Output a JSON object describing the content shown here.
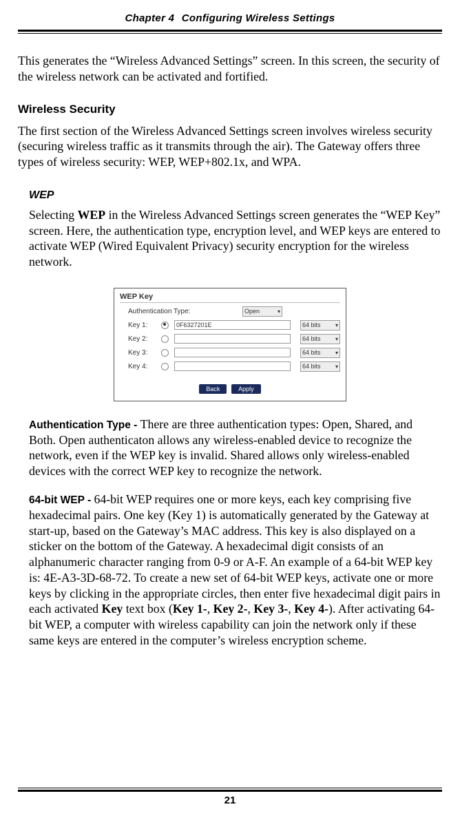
{
  "header": {
    "chapter_label": "Chapter 4",
    "chapter_title": "Configuring Wireless Settings"
  },
  "para_intro": "This generates the “Wireless Advanced Settings” screen. In this screen, the security of the wireless network can be activated and fortified.",
  "sec_wsec_heading": "Wireless Security",
  "para_wsec": "The first section of the Wireless Advanced Settings screen involves wireless security (securing wireless traffic as it transmits through the air). The Gateway offers three types of wireless security: WEP, WEP+802.1x, and WPA.",
  "sub_wep_heading": "WEP",
  "para_wep_pre": "Selecting ",
  "para_wep_bold": "WEP",
  "para_wep_post": " in the Wireless Advanced Settings screen generates the “WEP Key” screen. Here, the authentication type, encryption level, and WEP keys are entered to activate WEP (Wired Equivalent Privacy) security encryption for the wireless network.",
  "figure": {
    "title": "WEP Key",
    "auth_label": "Authentication Type:",
    "auth_value": "Open",
    "keys": [
      {
        "label": "Key 1:",
        "checked": true,
        "value": "0F6327201E",
        "bits": "64 bits"
      },
      {
        "label": "Key 2:",
        "checked": false,
        "value": "",
        "bits": "64 bits"
      },
      {
        "label": "Key 3:",
        "checked": false,
        "value": "",
        "bits": "64 bits"
      },
      {
        "label": "Key 4:",
        "checked": false,
        "value": "",
        "bits": "64 bits"
      }
    ],
    "btn_back": "Back",
    "btn_apply": "Apply"
  },
  "auth_label": "Authentication Type - ",
  "para_auth": "There are three authentication types: Open, Shared, and Both. Open authenticaton allows any wireless-enabled device to recognize the network, even if the WEP key is invalid. Shared allows only wireless-enabled devices with the correct WEP key to recognize the network.",
  "wep64_label": "64-bit WEP - ",
  "para_wep64_1": "64-bit WEP requires one or more keys, each key comprising five hexa­decimal pairs. One key (Key 1) is automatically generated by the Gateway at start-up, based on the Gateway’s MAC address. This key is also displayed on a sticker on the bottom of the Gateway. A hexadecimal digit consists of an alphanumeric char­acter ranging from 0-9 or A-F. An example of a 64-bit WEP key is: 4E-A3-3D-68-72. To create a new set of 64-bit WEP keys, activate one or more keys by clicking in the appropriate circles, then enter five hexadecimal digit pairs in each activated ",
  "para_wep64_key": "Key",
  "para_wep64_2": " text box (",
  "para_wep64_k1": "Key 1-",
  "para_wep64_c1": ", ",
  "para_wep64_k2": "Key 2-",
  "para_wep64_c2": ", ",
  "para_wep64_k3": "Key 3-",
  "para_wep64_c3": ", ",
  "para_wep64_k4": "Key 4-",
  "para_wep64_3": "). After activating 64-bit WEP, a computer with wireless capability can join the network only if these same keys are entered in the computer’s wireless encryption scheme.",
  "page_number": "21"
}
